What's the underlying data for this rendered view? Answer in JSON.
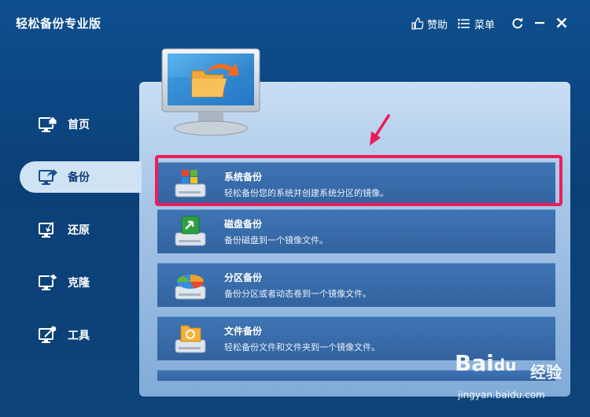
{
  "app": {
    "title": "轻松备份专业版"
  },
  "titlebar": {
    "sponsor_label": "赞助",
    "menu_label": "菜单"
  },
  "sidebar": {
    "items": [
      {
        "label": "首页",
        "icon": "home-monitor-icon",
        "active": false
      },
      {
        "label": "备份",
        "icon": "backup-monitor-icon",
        "active": true
      },
      {
        "label": "还原",
        "icon": "restore-monitor-icon",
        "active": false
      },
      {
        "label": "克隆",
        "icon": "clone-monitor-icon",
        "active": false
      },
      {
        "label": "工具",
        "icon": "tools-monitor-icon",
        "active": false
      }
    ]
  },
  "main": {
    "options": [
      {
        "title": "系统备份",
        "desc": "轻松备份您的系统并创建系统分区的镜像。",
        "icon": "windows-drive-icon"
      },
      {
        "title": "磁盘备份",
        "desc": "备份磁盘到一个镜像文件。",
        "icon": "disk-drive-icon"
      },
      {
        "title": "分区备份",
        "desc": "备份分区或者动态卷到一个镜像文件。",
        "icon": "partition-pie-icon"
      },
      {
        "title": "文件备份",
        "desc": "轻松备份文件和文件夹到一个镜像文件。",
        "icon": "folder-drive-icon"
      }
    ]
  },
  "watermark": {
    "logo": "Bai",
    "logo_paw": "du",
    "cn": "经验",
    "url": "jingyan.baidu.com"
  },
  "colors": {
    "background": "#0e4f8e",
    "panel": "#a9c8e8",
    "option": "#3f74b4",
    "highlight": "#ee1c5a"
  }
}
